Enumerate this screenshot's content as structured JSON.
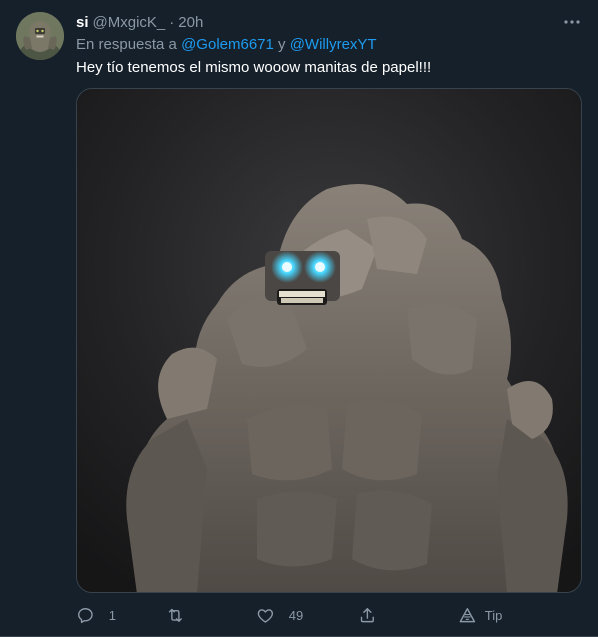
{
  "tweet": {
    "display_name": "si",
    "handle": "@MxgicK_",
    "separator": "·",
    "time": "20h",
    "reply_prefix": "En respuesta a ",
    "reply_mention_1": "@Golem6671",
    "reply_conjunction": " y ",
    "reply_mention_2": "@WillyrexYT",
    "text": "Hey tío tenemos el mismo wooow manitas de papel!!!",
    "media_icon": "golem-image"
  },
  "actions": {
    "reply_count": "1",
    "retweet_count": "",
    "like_count": "49",
    "tip_label": "Tip"
  },
  "icons": {
    "more": "more-icon",
    "reply": "reply-icon",
    "retweet": "retweet-icon",
    "like": "heart-icon",
    "share": "share-icon",
    "tip": "tip-icon"
  },
  "colors": {
    "background": "#15202b",
    "text": "#ffffff",
    "secondary": "#8b98a5",
    "accent": "#1d9bf0",
    "eye_glow": "#46d6ff"
  }
}
